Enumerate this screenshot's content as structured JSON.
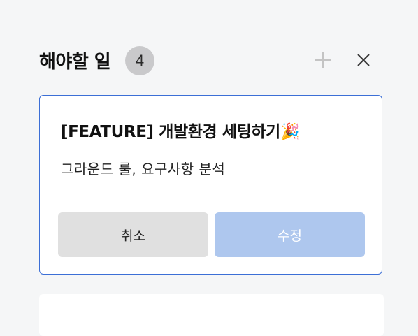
{
  "panel": {
    "title": "해야할 일",
    "count": "4",
    "add_icon": "plus-icon",
    "close_icon": "close-icon"
  },
  "card": {
    "title": "[FEATURE] 개발환경 세팅하기🎉",
    "description": "그라운드 룰, 요구사항 분석",
    "cancel_label": "취소",
    "edit_label": "수정"
  },
  "colors": {
    "card_border": "#3c6fd6",
    "cancel_bg": "#e0e0e0",
    "edit_bg": "#aec7ee",
    "badge_bg": "#c9c9cb",
    "background": "#f5f6f7"
  }
}
